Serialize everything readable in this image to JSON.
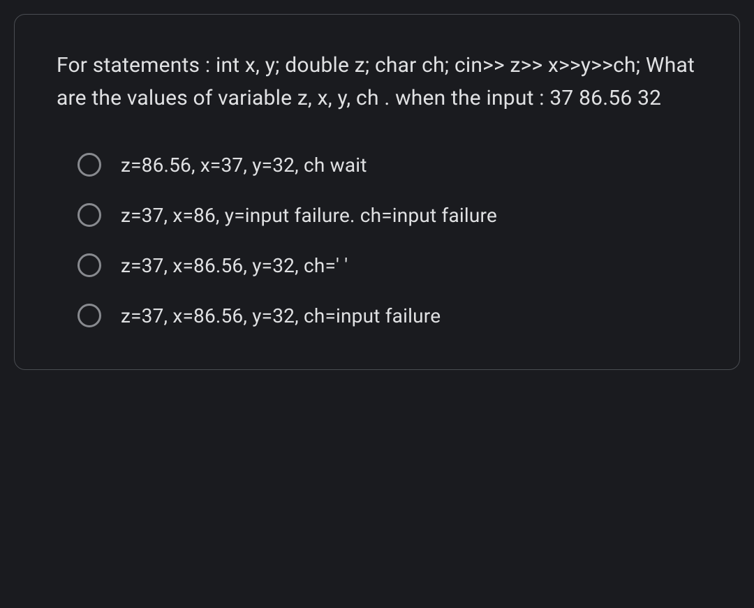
{
  "question": {
    "text": "For statements : int x, y; double z; char ch; cin>> z>> x>>y>>ch; What are the values of variable z, x, y, ch . when the input : 37 86.56 32"
  },
  "options": [
    {
      "label": "z=86.56, x=37, y=32, ch wait"
    },
    {
      "label": "z=37, x=86, y=input failure. ch=input failure"
    },
    {
      "label": "z=37, x=86.56, y=32, ch=' '"
    },
    {
      "label": "z=37, x=86.56, y=32, ch=input failure"
    }
  ]
}
